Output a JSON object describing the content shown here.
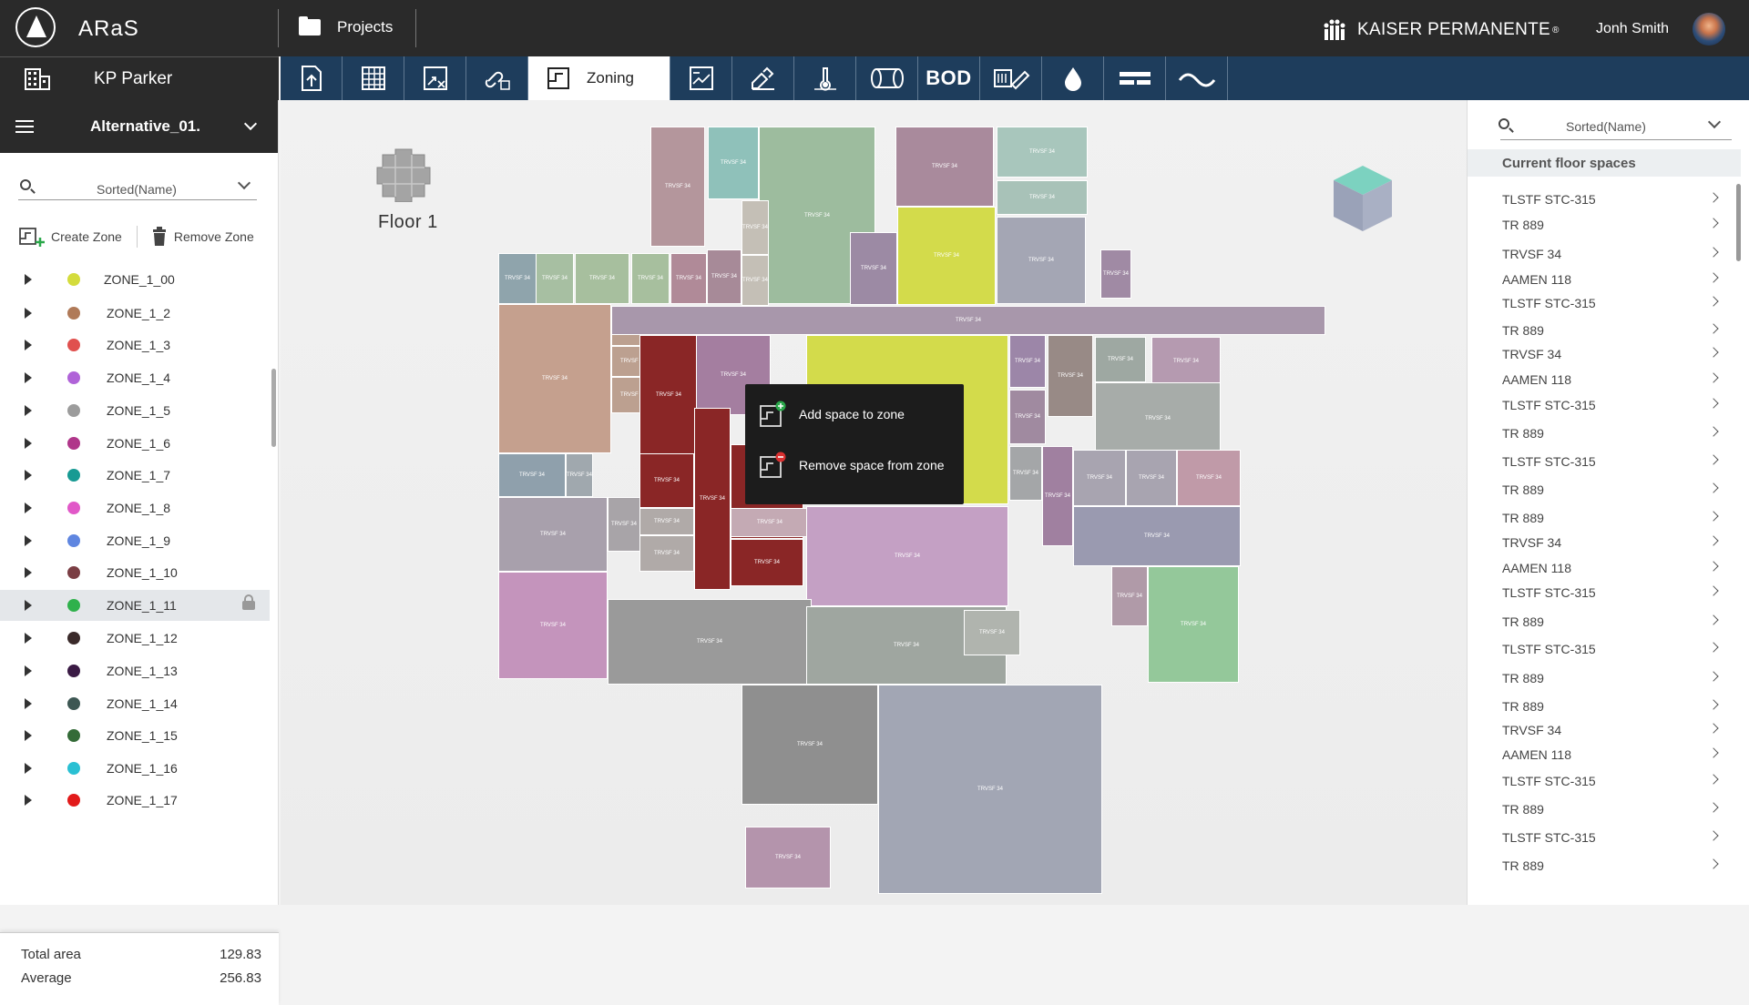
{
  "app": {
    "name": "ARaS",
    "projects_label": "Projects",
    "brand": "KAISER PERMANENTE",
    "user_name": "Jonh Smith"
  },
  "project": {
    "name": "KP Parker"
  },
  "toolbar": {
    "active_tab_label": "Zoning",
    "bod_label": "BOD",
    "tools": [
      "upload-icon",
      "grid-icon",
      "floorplan-icon",
      "link-icon",
      "zoning-icon",
      "layers-icon",
      "edit-icon",
      "thermometer-icon",
      "duct-icon",
      "bod",
      "valve-icon",
      "drop-icon",
      "pipe-icon",
      "wave-icon"
    ]
  },
  "left_panel": {
    "alternative": "Alternative_01.",
    "sort_label": "Sorted(Name)",
    "create_zone": "Create Zone",
    "remove_zone": "Remove Zone",
    "zones": [
      {
        "label": "ZONE_1_00",
        "color": "#d4dc3c"
      },
      {
        "label": "ZONE_1_2",
        "color": "#b07a58"
      },
      {
        "label": "ZONE_1_3",
        "color": "#e0504e"
      },
      {
        "label": "ZONE_1_4",
        "color": "#b063d8"
      },
      {
        "label": "ZONE_1_5",
        "color": "#9c9c9c"
      },
      {
        "label": "ZONE_1_6",
        "color": "#b0368a"
      },
      {
        "label": "ZONE_1_7",
        "color": "#179a93"
      },
      {
        "label": "ZONE_1_8",
        "color": "#e158c8"
      },
      {
        "label": "ZONE_1_9",
        "color": "#5f86e0"
      },
      {
        "label": "ZONE_1_10",
        "color": "#7b3e44"
      },
      {
        "label": "ZONE_1_11",
        "color": "#2fb14c",
        "selected": true,
        "locked": true
      },
      {
        "label": "ZONE_1_12",
        "color": "#3a2a2a"
      },
      {
        "label": "ZONE_1_13",
        "color": "#3a1a44"
      },
      {
        "label": "ZONE_1_14",
        "color": "#3d5753"
      },
      {
        "label": "ZONE_1_15",
        "color": "#346b38"
      },
      {
        "label": "ZONE_1_16",
        "color": "#2ac0d3"
      },
      {
        "label": "ZONE_1_17",
        "color": "#e21a1a"
      }
    ],
    "totals": {
      "total_area_label": "Total area",
      "total_area_value": "129.83",
      "average_label": "Average",
      "average_value": "256.83"
    }
  },
  "main": {
    "floor_label": "Floor 1",
    "space_tag": "TRVSF 34",
    "context_menu": {
      "add": "Add space to zone",
      "remove": "Remove space from zone"
    }
  },
  "right_panel": {
    "sort_label": "Sorted(Name)",
    "header": "Current floor spaces",
    "spaces": [
      "TLSTF STC-315",
      "TR 889",
      "TRVSF 34",
      "AAMEN 118",
      "TLSTF STC-315",
      "TR 889",
      "TRVSF 34",
      "AAMEN 118",
      "TLSTF STC-315",
      "TR 889",
      "TLSTF STC-315",
      "TR 889",
      "TR 889",
      "TRVSF 34",
      "AAMEN 118",
      "TLSTF STC-315",
      "TR 889",
      "TLSTF STC-315",
      "TR 889",
      "TR 889",
      "TRVSF 34",
      "AAMEN 118",
      "TLSTF STC-315",
      "TR 889",
      "TLSTF STC-315",
      "TR 889"
    ]
  }
}
